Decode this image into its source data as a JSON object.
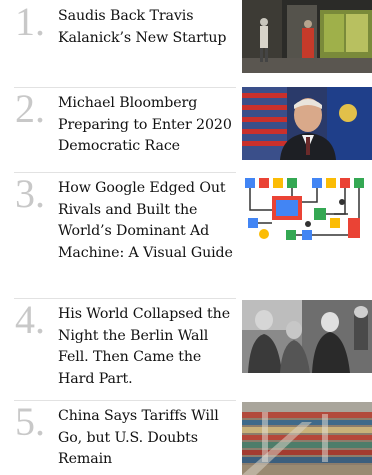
{
  "articles": [
    {
      "rank": "1.",
      "title": "Saudis Back Travis Kalanick’s New Startup",
      "image_icon": "photo-street-scene"
    },
    {
      "rank": "2.",
      "title": "Michael Bloomberg Preparing to Enter 2020 Democratic Race",
      "image_icon": "photo-bloomberg-portrait"
    },
    {
      "rank": "3.",
      "title": "How Google Edged Out Rivals and Built the World’s Dominant Ad Machine: A Visual Guide",
      "image_icon": "illustration-ad-machine"
    },
    {
      "rank": "4.",
      "title": "His World Collapsed the Night the Berlin Wall Fell. Then Came the Hard Part.",
      "image_icon": "photo-berlin-wall-bw"
    },
    {
      "rank": "5.",
      "title": "China Says Tariffs Will Go, but U.S. Doubts Remain",
      "image_icon": "photo-container-port"
    }
  ]
}
